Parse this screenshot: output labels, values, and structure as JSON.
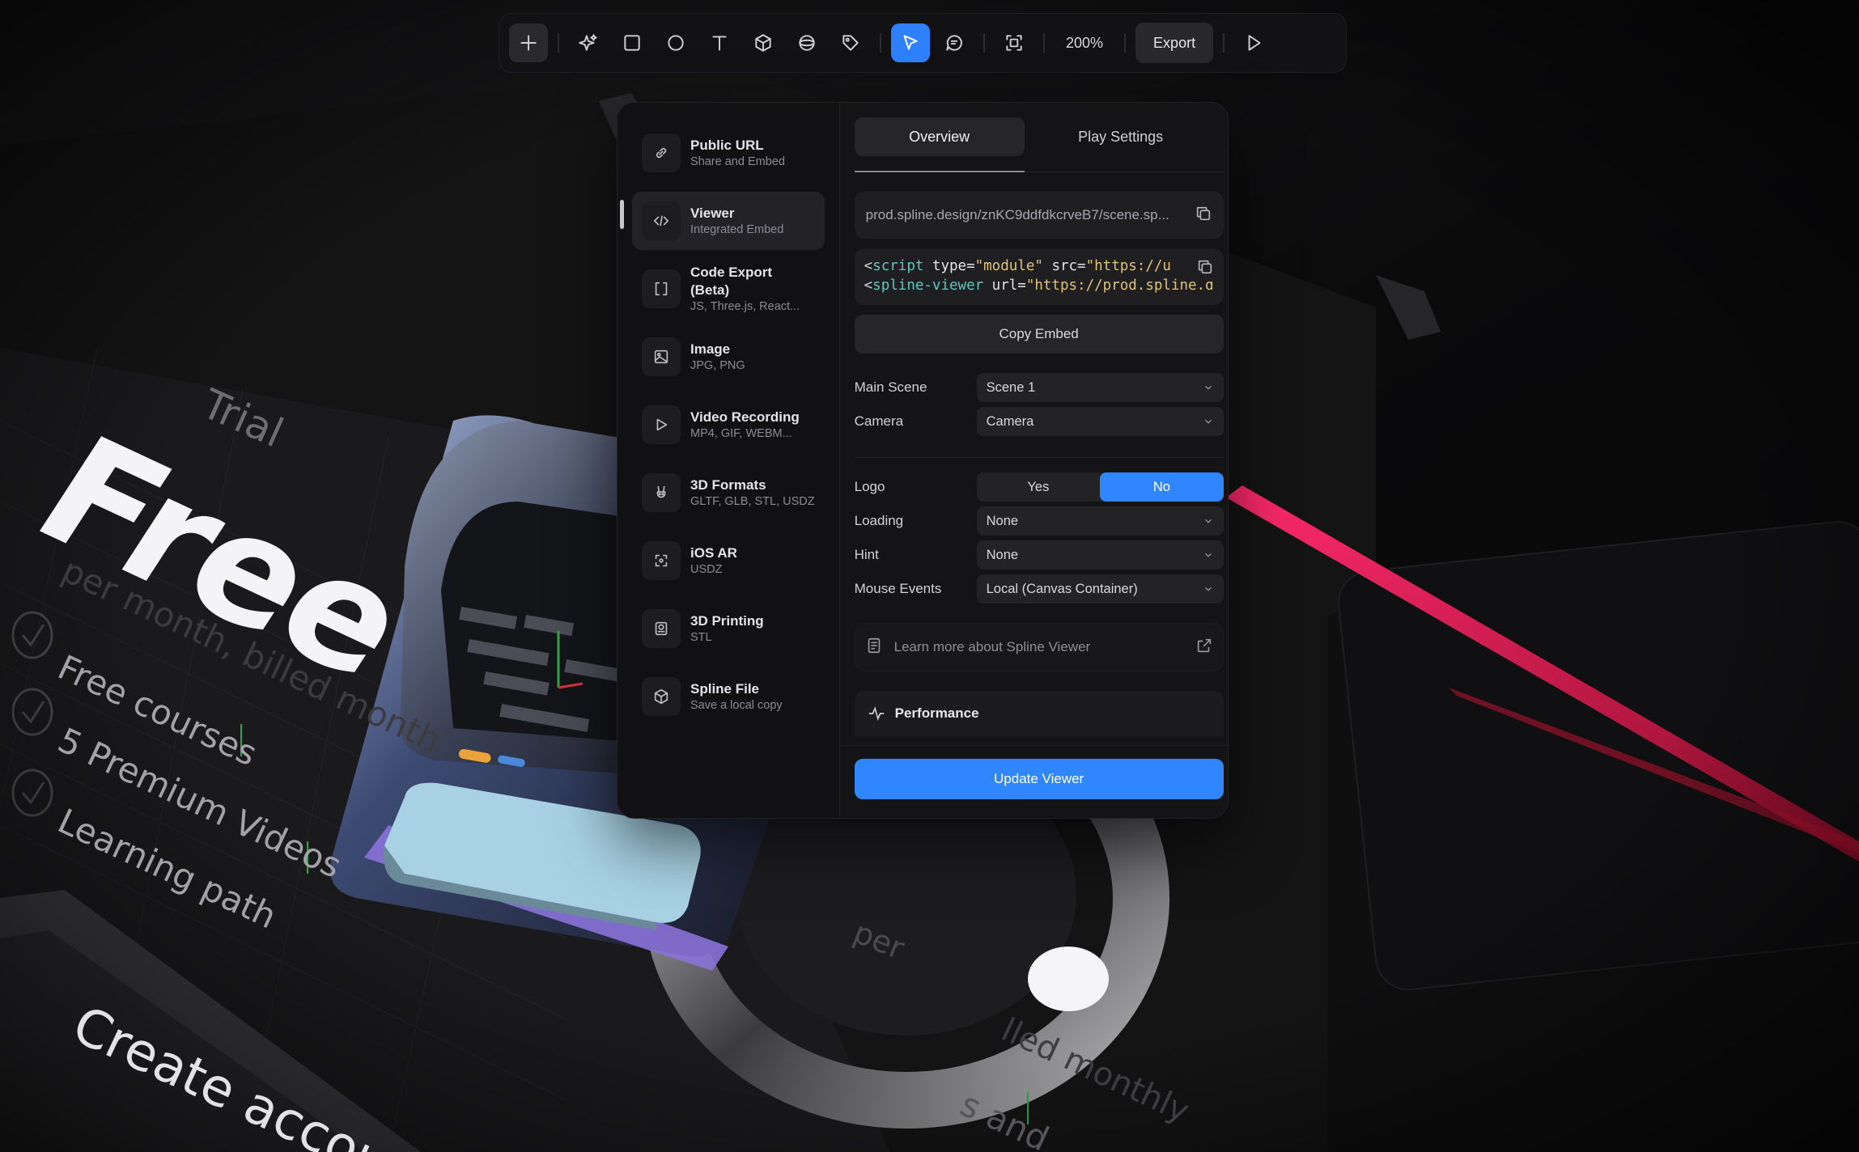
{
  "toolbar": {
    "zoom": "200%",
    "export_label": "Export",
    "tools": [
      "add-icon",
      "magic-icon",
      "rectangle-icon",
      "ellipse-icon",
      "text-icon",
      "cube-icon",
      "sphere-icon",
      "tag-icon",
      "pointer-icon",
      "comment-icon",
      "frame-icon",
      "play-icon"
    ],
    "active_tool": "pointer-icon"
  },
  "export_panel": {
    "sidebar": [
      {
        "title": "Public URL",
        "subtitle": "Share and Embed",
        "icon": "link-icon"
      },
      {
        "title": "Viewer",
        "subtitle": "Integrated Embed",
        "icon": "code-icon"
      },
      {
        "title": "Code Export (Beta)",
        "subtitle": "JS, Three.js, React...",
        "icon": "brackets-icon"
      },
      {
        "title": "Image",
        "subtitle": "JPG, PNG",
        "icon": "image-icon"
      },
      {
        "title": "Video Recording",
        "subtitle": "MP4, GIF, WEBM...",
        "icon": "play-icon"
      },
      {
        "title": "3D Formats",
        "subtitle": "GLTF, GLB, STL, USDZ",
        "icon": "rabbit-icon"
      },
      {
        "title": "iOS AR",
        "subtitle": "USDZ",
        "icon": "ar-icon"
      },
      {
        "title": "3D Printing",
        "subtitle": "STL",
        "icon": "printer-icon"
      },
      {
        "title": "Spline File",
        "subtitle": "Save a local copy",
        "icon": "box-icon"
      }
    ],
    "active_item": "Viewer",
    "tabs": [
      "Overview",
      "Play Settings"
    ],
    "active_tab": "Overview",
    "url": "prod.spline.design/znKC9ddfdkcrveB7/scene.sp...",
    "embed_line1": {
      "open": "<",
      "tag": "script",
      "attr1": " type=",
      "val1": "\"module\"",
      "attr2": " src=",
      "val2": "\"https://u"
    },
    "embed_line2": {
      "open": "<",
      "tag": "spline-viewer",
      "attr1": " url=",
      "val1": "\"https://prod.spline.d"
    },
    "copy_embed": "Copy Embed",
    "main_scene_label": "Main Scene",
    "main_scene_value": "Scene 1",
    "camera_label": "Camera",
    "camera_value": "Camera",
    "logo_label": "Logo",
    "logo_options": [
      "Yes",
      "No"
    ],
    "logo_selected": "No",
    "loading_label": "Loading",
    "loading_value": "None",
    "hint_label": "Hint",
    "hint_value": "None",
    "mouse_events_label": "Mouse Events",
    "mouse_events_value": "Local (Canvas Container)",
    "learn_more": "Learn more about Spline Viewer",
    "performance": "Performance",
    "update_button": "Update Viewer"
  },
  "scene": {
    "free": "Free",
    "trial": "Trial",
    "per_month": "per month, billed month",
    "features": [
      "Free courses",
      "5 Premium Videos",
      "Learning path"
    ],
    "create_account": "Create accou",
    "per_right": "per",
    "billed_right": "lled monthly",
    "s_and": "s and"
  },
  "colors": {
    "accent": "#2f86ff",
    "panel_bg": "#141416",
    "neon_stripe": "#ff2a6d"
  }
}
